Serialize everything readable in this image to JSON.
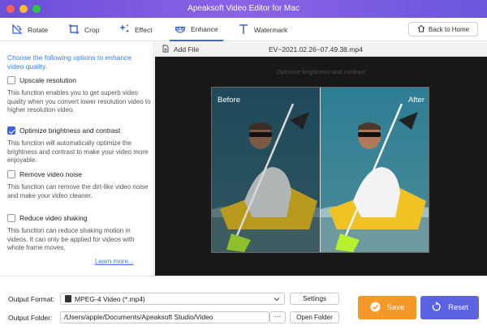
{
  "window": {
    "title": "Apeaksoft Video Editor for Mac"
  },
  "toolbar": {
    "tabs": [
      {
        "label": "Rotate",
        "icon": "rotate-icon"
      },
      {
        "label": "Crop",
        "icon": "crop-icon"
      },
      {
        "label": "Effect",
        "icon": "effect-icon"
      },
      {
        "label": "Enhance",
        "icon": "enhance-icon",
        "active": true
      },
      {
        "label": "Watermark",
        "icon": "watermark-icon"
      }
    ],
    "back_label": "Back to Home"
  },
  "enhance_panel": {
    "intro": "Choose the following options to enhance video quality.",
    "options": [
      {
        "label": "Upscale resolution",
        "checked": false,
        "description": "This function enables you to get superb video quality when you convert lower resolution video to higher resolution video."
      },
      {
        "label": "Optimize brightness and contrast",
        "checked": true,
        "description": "This function will automatically optimize the brightness and contrast to make your video more enjoyable."
      },
      {
        "label": "Remove video noise",
        "checked": false,
        "description": "This function can remove the dirt-like video noise and make your video cleaner."
      },
      {
        "label": "Reduce video shaking",
        "checked": false,
        "description": "This function can reduce shaking motion in videos. It can only be applied for videos with whole frame moves."
      }
    ],
    "learn_more": "Learn more..."
  },
  "preview": {
    "add_file": "Add File",
    "filename": "EV~2021.02.26~07.49.38.mp4",
    "hint": "Optimize brightness and contrast",
    "before_label": "Before",
    "after_label": "After"
  },
  "output": {
    "format_label": "Output Format:",
    "format_value": "MPEG-4 Video (*.mp4)",
    "settings_label": "Settings",
    "folder_label": "Output Folder:",
    "folder_value": "/Users/apple/Documents/Apeaksoft Studio/Video",
    "browse_label": "···",
    "open_folder_label": "Open Folder",
    "save_label": "Save",
    "reset_label": "Reset"
  },
  "colors": {
    "title_gradient": [
      "#6b4fd8",
      "#8a63e6"
    ],
    "accent_blue": "#3d64d8",
    "save_orange": "#f5982a",
    "reset_purple": "#5c63e0",
    "link_blue": "#3a7de0"
  }
}
